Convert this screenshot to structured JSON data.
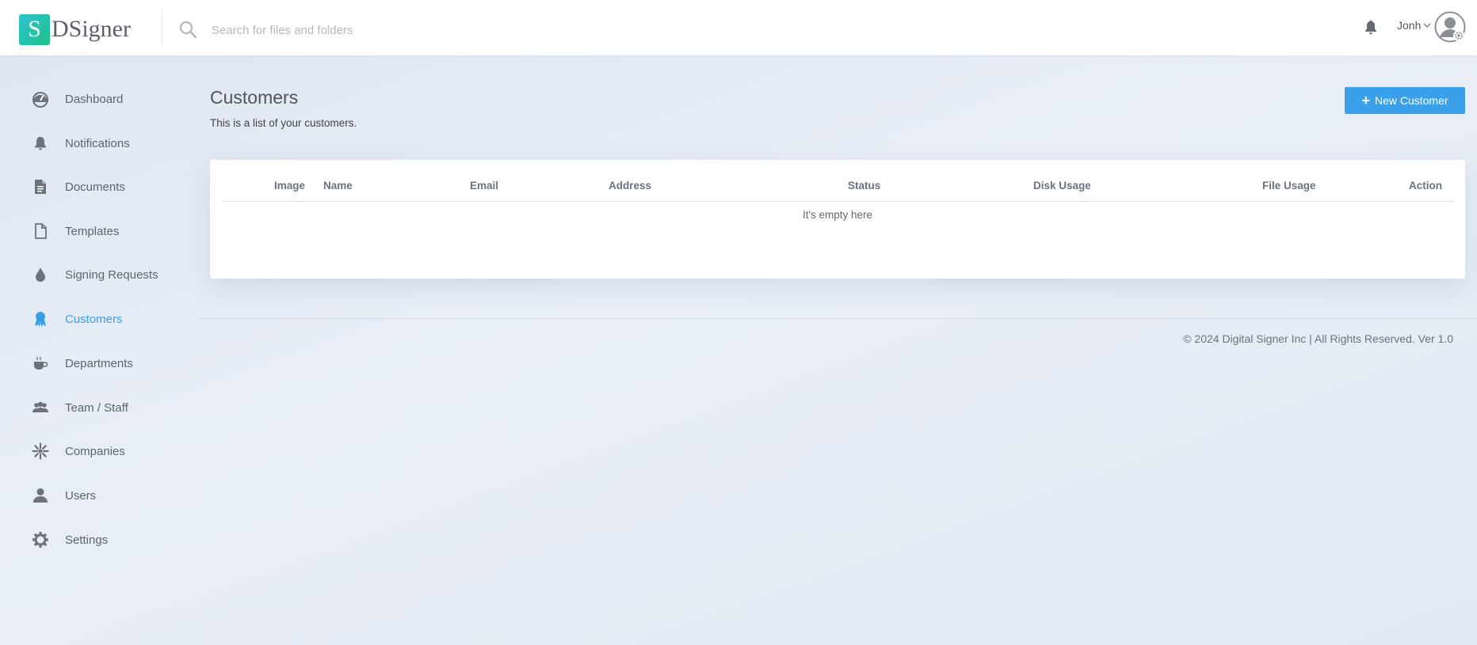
{
  "app": {
    "logo_letter": "S",
    "logo_text": "DSigner",
    "brand_color": "#1fbf8a"
  },
  "header": {
    "search_placeholder": "Search for files and folders",
    "user_name": "Jonh",
    "icons": [
      "search-icon",
      "bell-icon",
      "chevron-down-icon",
      "avatar-gear-icon"
    ]
  },
  "sidebar": {
    "items": [
      {
        "label": "Dashboard",
        "icon": "dashboard-icon",
        "active": false
      },
      {
        "label": "Notifications",
        "icon": "bell-icon",
        "active": false
      },
      {
        "label": "Documents",
        "icon": "document-icon",
        "active": false
      },
      {
        "label": "Templates",
        "icon": "file-outline-icon",
        "active": false
      },
      {
        "label": "Signing Requests",
        "icon": "drop-icon",
        "active": false
      },
      {
        "label": "Customers",
        "icon": "badge-icon",
        "active": true
      },
      {
        "label": "Departments",
        "icon": "coffee-icon",
        "active": false
      },
      {
        "label": "Team / Staff",
        "icon": "group-icon",
        "active": false
      },
      {
        "label": "Companies",
        "icon": "sunburst-icon",
        "active": false
      },
      {
        "label": "Users",
        "icon": "user-icon",
        "active": false
      },
      {
        "label": "Settings",
        "icon": "gear-icon",
        "active": false
      }
    ],
    "active_color": "#3aa0e6"
  },
  "main": {
    "title": "Customers",
    "subtitle": "This is a list of your customers.",
    "new_button_label": "New Customer",
    "button_color": "#3aa0e9",
    "table": {
      "columns": [
        "Image",
        "Name",
        "Email",
        "Address",
        "Status",
        "Disk Usage",
        "File Usage",
        "Action"
      ],
      "rows": [],
      "empty_text": "It's empty here"
    }
  },
  "footer": {
    "text": "© 2024 Digital Signer Inc | All Rights Reserved. Ver 1.0"
  }
}
